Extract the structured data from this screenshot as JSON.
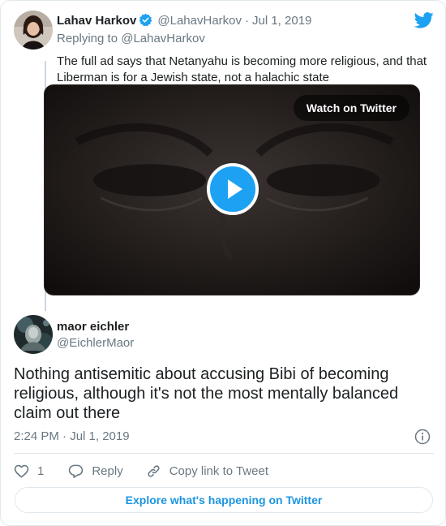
{
  "colors": {
    "accent": "#1da1f2",
    "link": "#1b95e0",
    "secondary_text": "#697882",
    "border": "#e1e8ed"
  },
  "parent_tweet": {
    "author_name": "Lahav Harkov",
    "verified_icon": "verified-badge-icon",
    "handle": "@LahavHarkov",
    "separator": "·",
    "date": "Jul 1, 2019",
    "replying_to": "Replying to @LahavHarkov",
    "text": "The full ad says that Netanyahu is becoming more religious, and that Liberman is for a Jewish state, not a halachic state",
    "media": {
      "watch_label": "Watch on Twitter",
      "play_icon": "play-icon"
    }
  },
  "brand_icon": "twitter-bird-icon",
  "main_tweet": {
    "author_name": "maor eichler",
    "handle": "@EichlerMaor",
    "text": "Nothing antisemitic about accusing Bibi of becoming religious, although it's not the most mentally balanced claim out there",
    "timestamp": "2:24 PM · Jul 1, 2019",
    "info_icon": "info-icon"
  },
  "actions": {
    "like_count": "1",
    "reply_label": "Reply",
    "copy_link_label": "Copy link to Tweet"
  },
  "explore_label": "Explore what's happening on Twitter"
}
